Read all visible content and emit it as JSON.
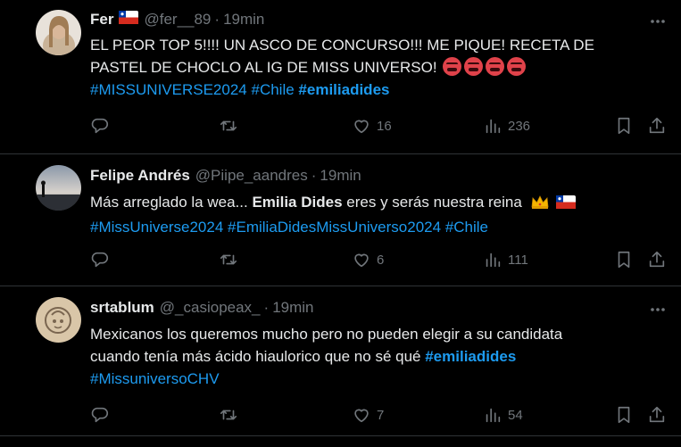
{
  "tweets": [
    {
      "name": "Fer",
      "handle": "@fer__89",
      "time": "19min",
      "text_line1": "EL PEOR TOP 5!!!! UN ASCO DE CONCURSO!!! ME PIQUE! RECETA DE",
      "text_line2": "PASTEL DE CHOCLO AL IG DE MISS UNIVERSO!",
      "tag1": "#MISSUNIVERSE2024",
      "tag2": "#Chile",
      "tag3": "#emiliadides",
      "likes": "16",
      "views": "236",
      "emoji_count": 4
    },
    {
      "name": "Felipe Andrés",
      "handle": "@Piipe_aandres",
      "time": "19min",
      "text_a": "Más arreglado la wea...",
      "text_b": "Emilia Dides",
      "text_c": "eres y serás nuestra reina",
      "tag1": "#MissUniverse2024",
      "tag2": "#EmiliaDidesMissUniverso2024",
      "tag3": "#Chile",
      "likes": "6",
      "views": "111"
    },
    {
      "name": "srtablum",
      "handle": "@_casiopeax_",
      "time": "19min",
      "text_line1": "Mexicanos los queremos mucho pero no pueden elegir a su candidata",
      "text_line2": "cuando tenía más ácido hiaulorico que no sé qué",
      "tag1": "#emiliadides",
      "tag2": "#MissuniversoCHV",
      "likes": "7",
      "views": "54"
    }
  ],
  "separator": "·",
  "icons": {
    "more": "more-icon",
    "reply": "reply-icon",
    "retweet": "retweet-icon",
    "like": "heart-icon",
    "views": "views-icon",
    "bookmark": "bookmark-icon",
    "share": "share-icon"
  },
  "colors": {
    "link": "#1d9bf0",
    "muted": "#71767b",
    "text": "#e7e9ea",
    "background": "#000000"
  }
}
